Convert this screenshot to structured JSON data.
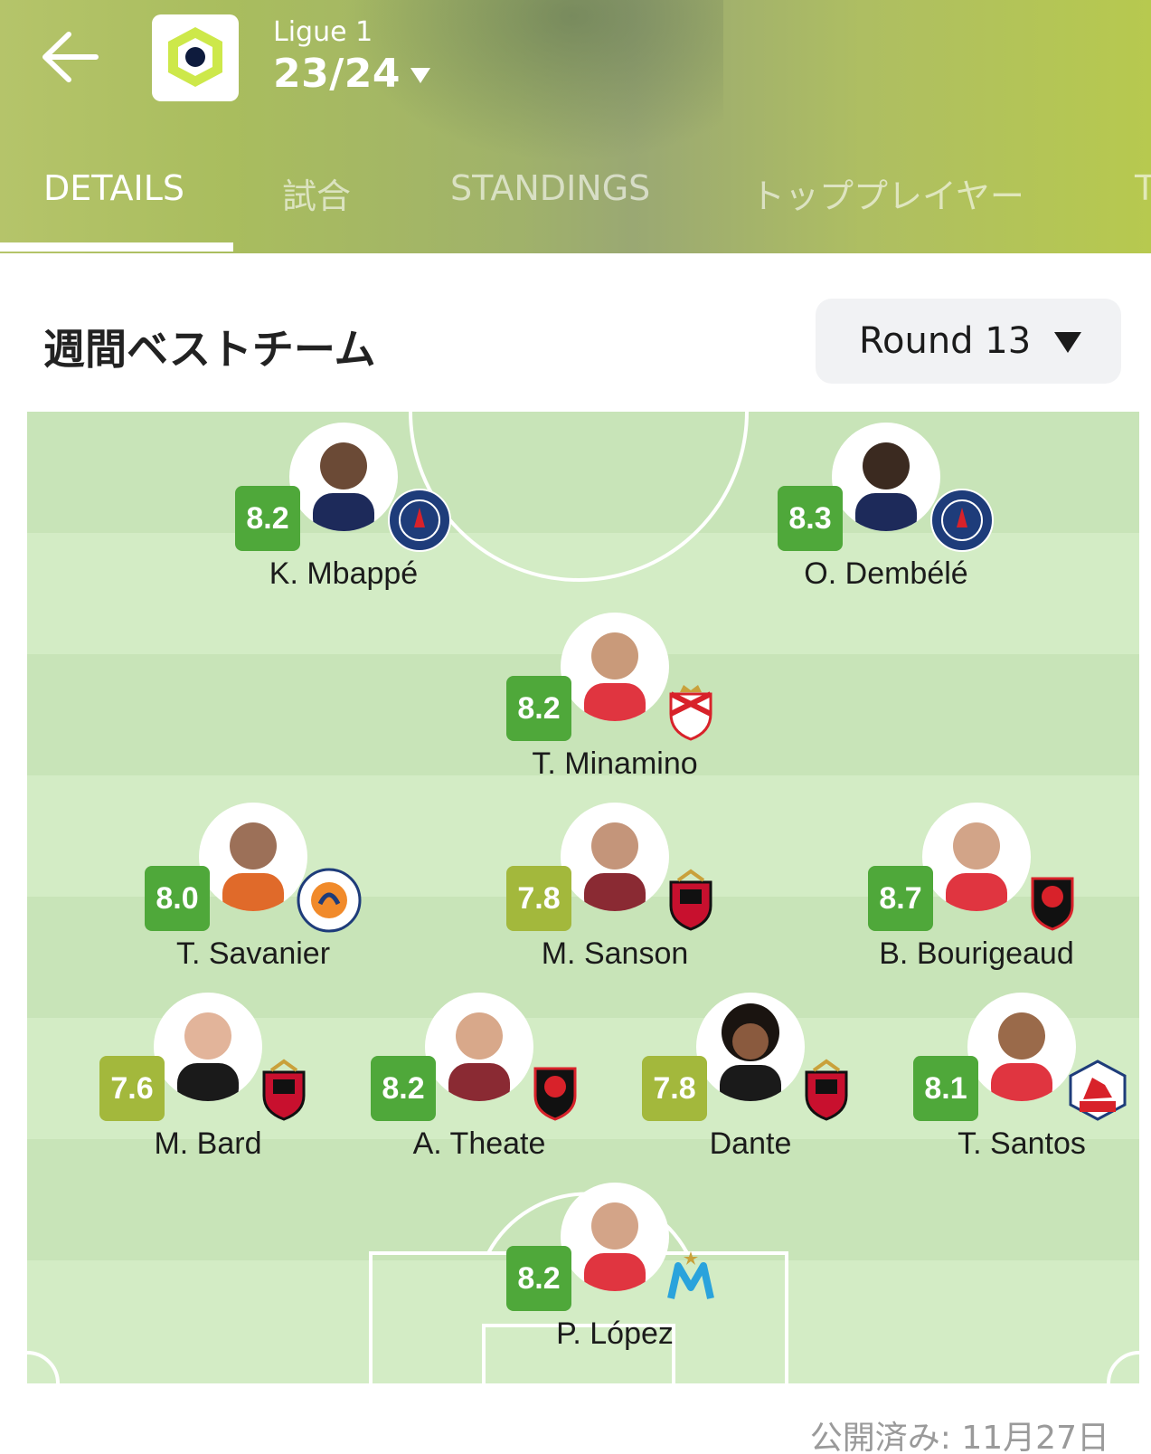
{
  "header": {
    "league_name": "Ligue 1",
    "season": "23/24",
    "tabs": [
      {
        "label": "DETAILS",
        "active": true
      },
      {
        "label": "試合",
        "active": false
      },
      {
        "label": "STANDINGS",
        "active": false
      },
      {
        "label": "トッププレイヤー",
        "active": false
      },
      {
        "label": "T",
        "active": false
      }
    ]
  },
  "section": {
    "title": "週間ベストチーム",
    "round_select": "Round 13"
  },
  "colors": {
    "header_accent": "#b3c45c",
    "rating_high": "#4fa83a",
    "rating_mid": "#a3b83c",
    "pitch_light": "#d3ecc5",
    "pitch_dark": "#c8e4b8"
  },
  "players": [
    {
      "name": "K. Mbappé",
      "rating": "8.2",
      "club": "Paris Saint-Germain",
      "club_icon": "psg-crest-icon",
      "tier": "high"
    },
    {
      "name": "O. Dembélé",
      "rating": "8.3",
      "club": "Paris Saint-Germain",
      "club_icon": "psg-crest-icon",
      "tier": "high"
    },
    {
      "name": "T. Minamino",
      "rating": "8.2",
      "club": "AS Monaco",
      "club_icon": "monaco-crest-icon",
      "tier": "high"
    },
    {
      "name": "T. Savanier",
      "rating": "8.0",
      "club": "Montpellier",
      "club_icon": "montpellier-crest-icon",
      "tier": "high"
    },
    {
      "name": "M. Sanson",
      "rating": "7.8",
      "club": "OGC Nice",
      "club_icon": "nice-crest-icon",
      "tier": "mid"
    },
    {
      "name": "B. Bourigeaud",
      "rating": "8.7",
      "club": "Stade Rennais",
      "club_icon": "rennes-crest-icon",
      "tier": "high"
    },
    {
      "name": "M. Bard",
      "rating": "7.6",
      "club": "OGC Nice",
      "club_icon": "nice-crest-icon",
      "tier": "mid"
    },
    {
      "name": "A. Theate",
      "rating": "8.2",
      "club": "Stade Rennais",
      "club_icon": "rennes-crest-icon",
      "tier": "high"
    },
    {
      "name": "Dante",
      "rating": "7.8",
      "club": "OGC Nice",
      "club_icon": "nice-crest-icon",
      "tier": "mid"
    },
    {
      "name": "T. Santos",
      "rating": "8.1",
      "club": "LOSC Lille",
      "club_icon": "lille-crest-icon",
      "tier": "high"
    },
    {
      "name": "P. López",
      "rating": "8.2",
      "club": "Olympique de Marseille",
      "club_icon": "marseille-crest-icon",
      "tier": "high"
    }
  ],
  "footer": {
    "published": "公開済み: 11月27日"
  }
}
